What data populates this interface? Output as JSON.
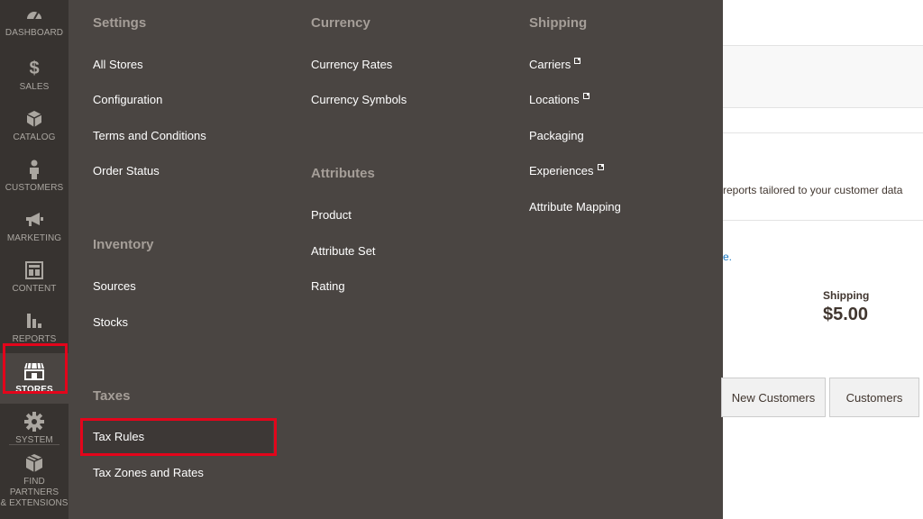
{
  "nav": {
    "items": [
      {
        "id": "dashboard",
        "label": "DASHBOARD",
        "icon": "dashboard-icon"
      },
      {
        "id": "sales",
        "label": "SALES",
        "icon": "dollar-icon"
      },
      {
        "id": "catalog",
        "label": "CATALOG",
        "icon": "cube-icon"
      },
      {
        "id": "customers",
        "label": "CUSTOMERS",
        "icon": "person-icon"
      },
      {
        "id": "marketing",
        "label": "MARKETING",
        "icon": "megaphone-icon"
      },
      {
        "id": "content",
        "label": "CONTENT",
        "icon": "layout-icon"
      },
      {
        "id": "reports",
        "label": "REPORTS",
        "icon": "bar-chart-icon"
      },
      {
        "id": "stores",
        "label": "STORES",
        "icon": "storefront-icon",
        "active": true
      },
      {
        "id": "system",
        "label": "SYSTEM",
        "icon": "gear-icon"
      },
      {
        "id": "partners",
        "label": "FIND PARTNERS\n& EXTENSIONS",
        "icon": "box-icon"
      }
    ]
  },
  "submenu": {
    "settings": {
      "title": "Settings",
      "links": [
        "All Stores",
        "Configuration",
        "Terms and Conditions",
        "Order Status"
      ]
    },
    "inventory": {
      "title": "Inventory",
      "links": [
        "Sources",
        "Stocks"
      ]
    },
    "taxes": {
      "title": "Taxes",
      "links": [
        "Tax Rules",
        "Tax Zones and Rates"
      ]
    },
    "currency": {
      "title": "Currency",
      "links": [
        "Currency Rates",
        "Currency Symbols"
      ]
    },
    "attributes": {
      "title": "Attributes",
      "links": [
        "Product",
        "Attribute Set",
        "Rating"
      ]
    },
    "shipping": {
      "title": "Shipping",
      "links": [
        "Carriers",
        "Locations",
        "Packaging",
        "Experiences",
        "Attribute Mapping"
      ]
    }
  },
  "background": {
    "reports_text": "reports tailored to your customer data",
    "link_fragment": "e.",
    "shipping_label": "Shipping",
    "shipping_value": "$5.00",
    "tabs": [
      "New Customers",
      "Customers"
    ]
  },
  "colors": {
    "nav_bg": "#373330",
    "submenu_bg": "#4a4542",
    "highlight": "#e3051b"
  }
}
